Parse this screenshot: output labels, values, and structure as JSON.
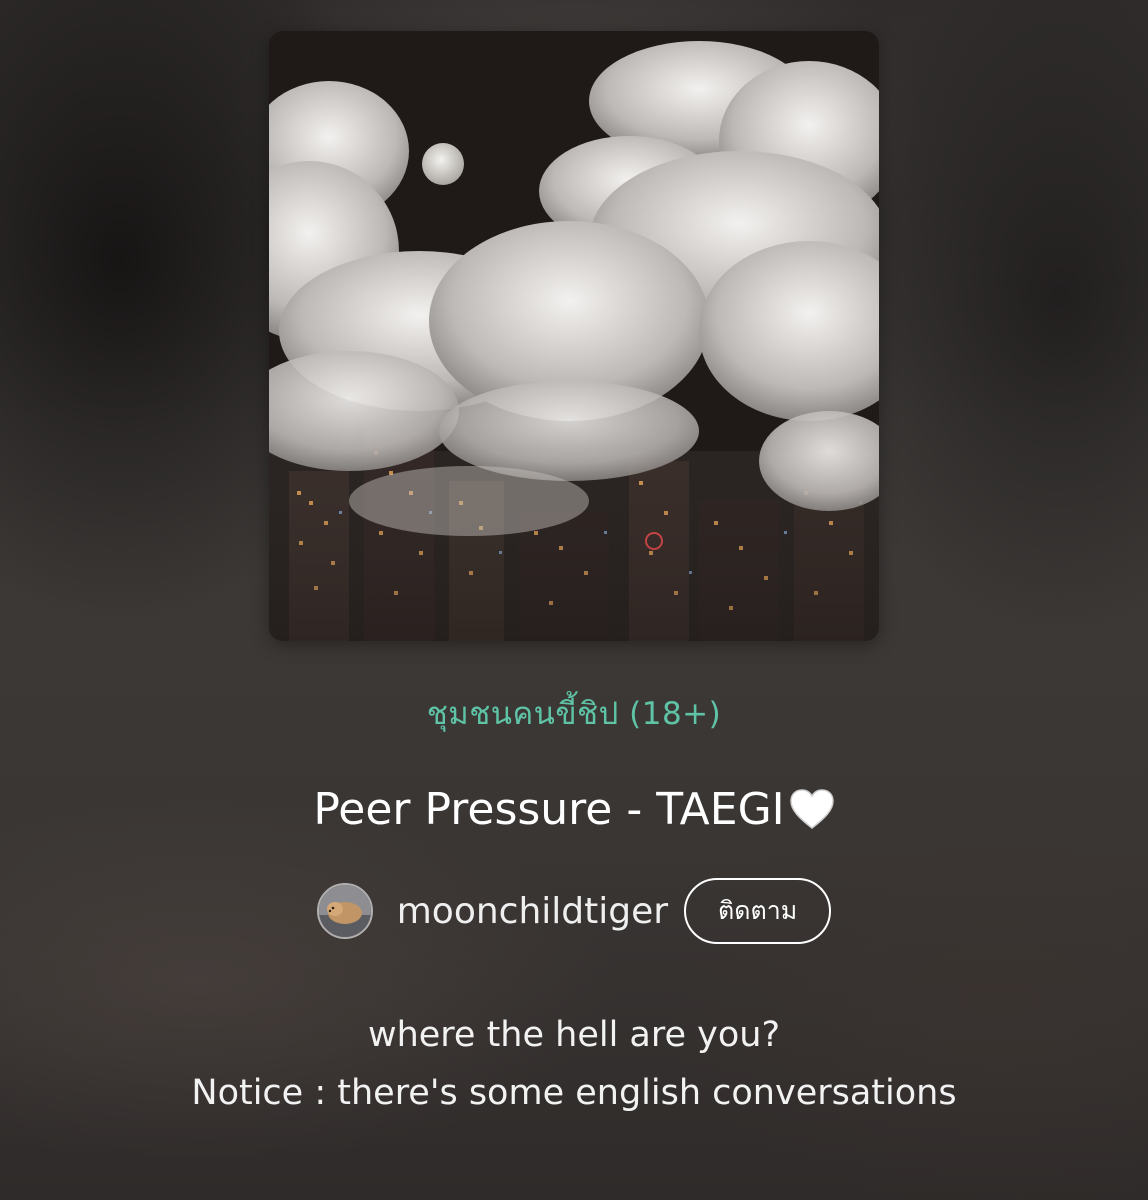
{
  "story": {
    "cover": {
      "icon": "cover-image",
      "description_colors": {
        "sky": "#1c1614",
        "cloud": "#d9d6d4"
      }
    },
    "community": "ชุมชนคนขี้ชิป (18+)",
    "title": "Peer Pressure - TAEGI",
    "title_emoji_icon": "white-heart-icon",
    "author": {
      "name": "moonchildtiger",
      "avatar_icon": "avatar"
    },
    "follow_label": "ติดตาม",
    "description_lines": [
      "where the hell are you?",
      "Notice : there's some english conversations"
    ]
  },
  "colors": {
    "accent": "#5fc3a6",
    "text": "#ffffff"
  }
}
